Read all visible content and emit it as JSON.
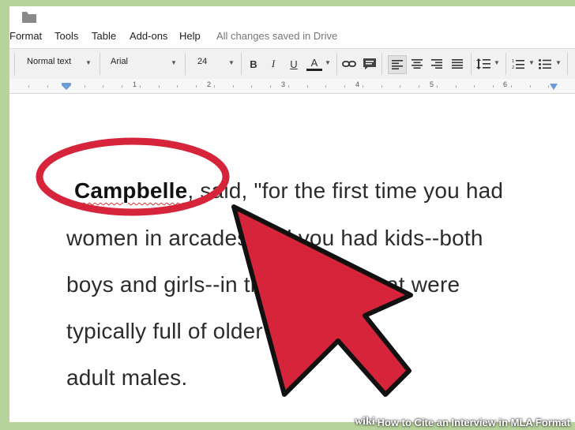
{
  "menu": {
    "items": [
      {
        "label": "Format"
      },
      {
        "label": "Tools"
      },
      {
        "label": "Table"
      },
      {
        "label": "Add-ons"
      },
      {
        "label": "Help"
      }
    ],
    "status": "All changes saved in Drive"
  },
  "toolbar": {
    "style": "Normal text",
    "font": "Arial",
    "size": "24",
    "bold_glyph": "B",
    "italic_glyph": "I",
    "underline_glyph": "U",
    "textcolor_glyph": "A"
  },
  "ruler": {
    "numbers": [
      "1",
      "2",
      "3",
      "4",
      "5",
      "6"
    ]
  },
  "document": {
    "name": "Campbelle",
    "line1_rest": ", said, \"for the first time you had",
    "line2": "women in arcades and you had kids--both",
    "line3": "boys and girls--in the arcades that were",
    "line4": "typically full of older teens and",
    "line5": "adult males."
  },
  "banner": {
    "logo": "wiki",
    "title": "How to Cite an Interview in MLA Format"
  },
  "colors": {
    "annotation_red": "#d6243a",
    "frame_green": "#b5d39a"
  }
}
